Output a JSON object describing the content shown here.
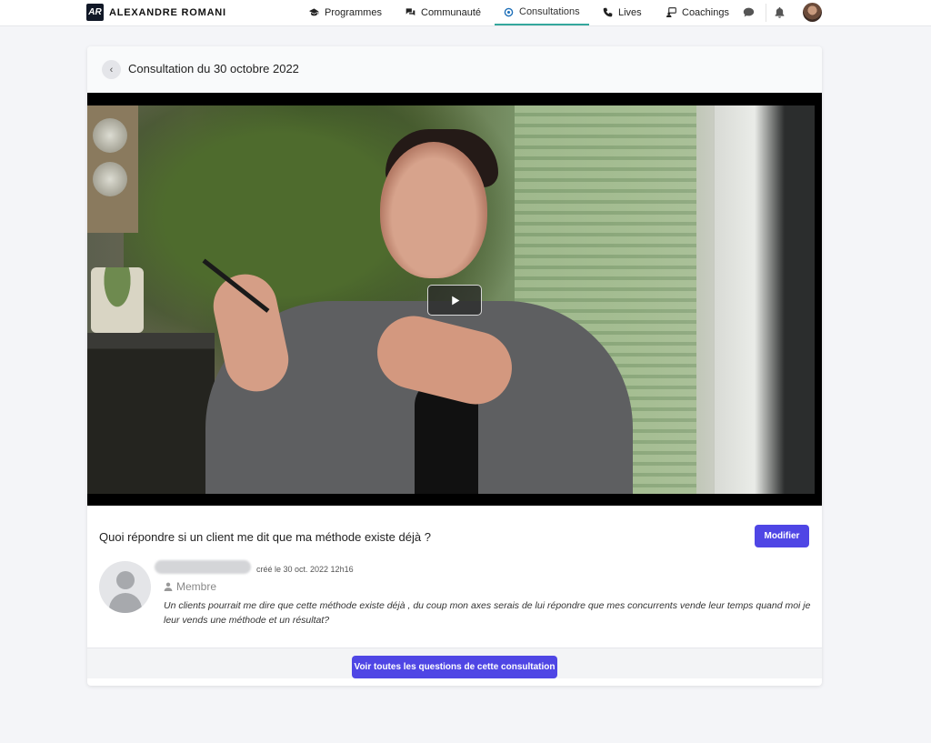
{
  "brand": {
    "logo_text": "AR",
    "name": "ALEXANDRE ROMANI"
  },
  "nav": {
    "items": [
      {
        "label": "Programmes",
        "icon": "graduation-cap-icon"
      },
      {
        "label": "Communauté",
        "icon": "chat-bubbles-icon"
      },
      {
        "label": "Consultations",
        "icon": "support-icon",
        "active": true
      },
      {
        "label": "Lives",
        "icon": "phone-icon"
      },
      {
        "label": "Coachings",
        "icon": "coaching-icon"
      }
    ],
    "messages_icon": "message-icon",
    "notifications_icon": "bell-icon",
    "avatar": "user-avatar"
  },
  "page": {
    "title": "Consultation du 30 octobre 2022",
    "back_icon": "chevron-left-icon"
  },
  "video": {
    "play_icon": "play-icon"
  },
  "question": {
    "title": "Quoi répondre si un client me dit que ma méthode existe déjà ?",
    "modify_label": "Modifier",
    "created": "créé le 30 oct. 2022 12h16",
    "role": "Membre",
    "body": "Un clients pourrait me dire que cette méthode existe déjà , du coup mon axes serais de lui répondre que mes concurrents vende leur temps quand moi je leur vends une méthode et un résultat?"
  },
  "footer": {
    "all_questions_label": "Voir toutes les questions de cette consultation"
  },
  "colors": {
    "accent": "#4f46e5",
    "active_nav": "#34a79d",
    "background": "#f4f5f8"
  }
}
